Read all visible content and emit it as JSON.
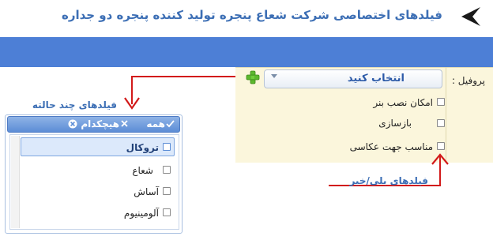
{
  "header": {
    "title": "فیلدهای اختصاصی شرکت شعاع پنجره  تولید کننده پنجره دو جداره"
  },
  "form": {
    "profile_label": "پروفیل :",
    "select_placeholder": "انتخاب کنید",
    "options": [
      {
        "label": "امکان نصب بنر",
        "checked": false
      },
      {
        "label": "بازسازی",
        "checked": false
      },
      {
        "label": "مناسب جهت عکاسی",
        "checked": false
      }
    ]
  },
  "annotations": {
    "multi_state": "فیلدهای چند حالته",
    "yes_no": "فیلدهای بلی/خیر"
  },
  "multiselect": {
    "select_all": "همه",
    "select_none": "هیچکدام",
    "items": [
      {
        "label": "تروکال",
        "checked": false,
        "highlighted": true
      },
      {
        "label": "شعاع",
        "checked": false,
        "highlighted": false
      },
      {
        "label": "آساش",
        "checked": false,
        "highlighted": false
      },
      {
        "label": "آلومینیوم",
        "checked": false,
        "highlighted": false
      }
    ]
  },
  "colors": {
    "brand_blue": "#4d7fd6",
    "title_blue": "#3d6fb5",
    "arrow_red": "#d21a1a",
    "panel_yellow": "#fbf6dc",
    "plus_green": "#5cb82e"
  }
}
